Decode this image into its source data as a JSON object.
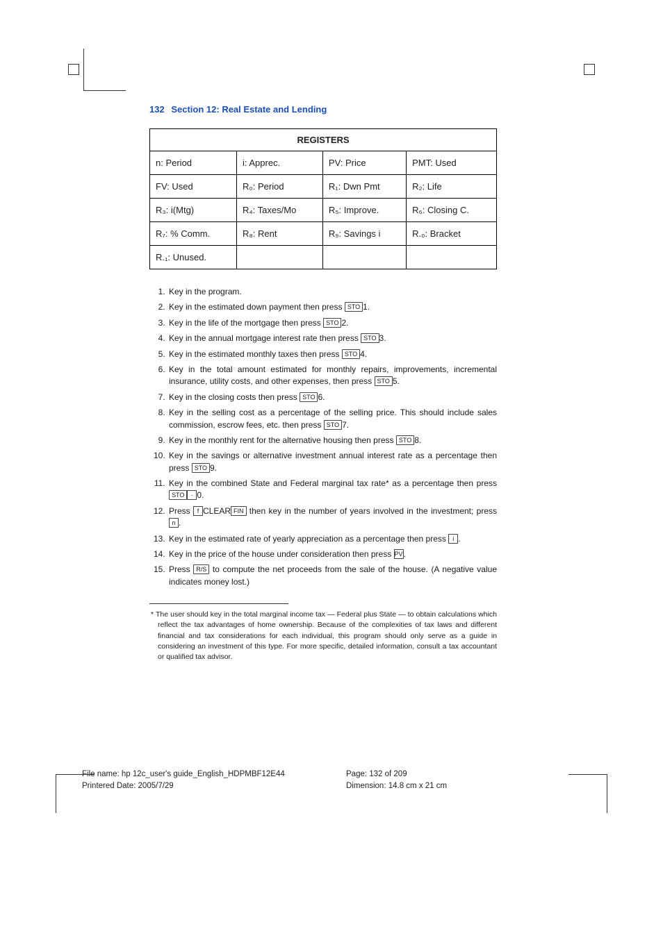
{
  "header": {
    "page_no": "132",
    "section": "Section 12:",
    "title": "Real Estate and Lending"
  },
  "registers": {
    "title": "REGISTERS",
    "rows": [
      [
        "n: Period",
        "i: Apprec.",
        "PV: Price",
        "PMT: Used"
      ],
      [
        "FV: Used",
        "R₀: Period",
        "R₁: Dwn Pmt",
        "R₂: Life"
      ],
      [
        "R₃: i(Mtg)",
        "R₄: Taxes/Mo",
        "R₅: Improve.",
        "R₆: Closing C."
      ],
      [
        "R₇: % Comm.",
        "R₈: Rent",
        "R₉: Savings i",
        "R.₀: Bracket"
      ],
      [
        "R.₁: Unused.",
        "",
        "",
        ""
      ]
    ]
  },
  "steps": [
    {
      "text_before": "Key in the program.",
      "key": null,
      "text_after": ""
    },
    {
      "text_before": "Key in the estimated down payment then press ",
      "key": "STO",
      "text_after": "1."
    },
    {
      "text_before": "Key in the life of the mortgage then press ",
      "key": "STO",
      "text_after": "2."
    },
    {
      "text_before": "Key in the annual mortgage interest rate then press ",
      "key": "STO",
      "text_after": "3."
    },
    {
      "text_before": "Key in the estimated monthly taxes then press ",
      "key": "STO",
      "text_after": "4."
    },
    {
      "text_before": "Key in the total amount estimated for monthly repairs, improvements, incremental insurance, utility costs, and other expenses, then press ",
      "key": "STO",
      "text_after": "5."
    },
    {
      "text_before": "Key in the closing costs then press ",
      "key": "STO",
      "text_after": "6."
    },
    {
      "text_before": "Key in the selling cost as a percentage of the selling price. This should include sales commission, escrow fees, etc. then press ",
      "key": "STO",
      "text_after": "7."
    },
    {
      "text_before": "Key in the monthly rent for the alternative housing then press ",
      "key": "STO",
      "text_after": "8."
    },
    {
      "text_before": "Key in the savings or alternative investment annual interest rate as a percentage then press ",
      "key": "STO",
      "text_after": "9."
    },
    {
      "text_before": "Key in the combined State and Federal marginal tax rate* as a percentage then press ",
      "key": "STO",
      "key2": "·",
      "text_after": "0."
    },
    {
      "text_before": "Press ",
      "key": "f",
      "mid": "CLEAR",
      "key2": "FIN",
      "text_after": " then key in the number of years involved in the investment; press ",
      "key3": "n",
      "tail": "."
    },
    {
      "text_before": "Key in the estimated rate of yearly appreciation as a percentage then press ",
      "key": "i",
      "text_after": "."
    },
    {
      "text_before": "Key in the price of the house under consideration then press ",
      "key": "PV",
      "text_after": "."
    },
    {
      "text_before": "Press ",
      "key": "R/S",
      "text_after": " to compute the net proceeds from the sale of the house. (A negative value indicates money lost.)"
    }
  ],
  "footnote": "* The user should key in the total marginal income tax — Federal plus State — to obtain calculations which reflect the tax advantages of home ownership. Because of the complexities of tax laws and different financial and tax considerations for each individual, this program should only serve as a guide in considering an investment of this type. For more specific, detailed information, consult a tax accountant or qualified tax advisor.",
  "footer": {
    "filename": "File name: hp 12c_user's guide_English_HDPMBF12E44",
    "printed": "Printered Date: 2005/7/29",
    "page": "Page: 132 of 209",
    "dim": "Dimension: 14.8 cm x 21 cm"
  }
}
